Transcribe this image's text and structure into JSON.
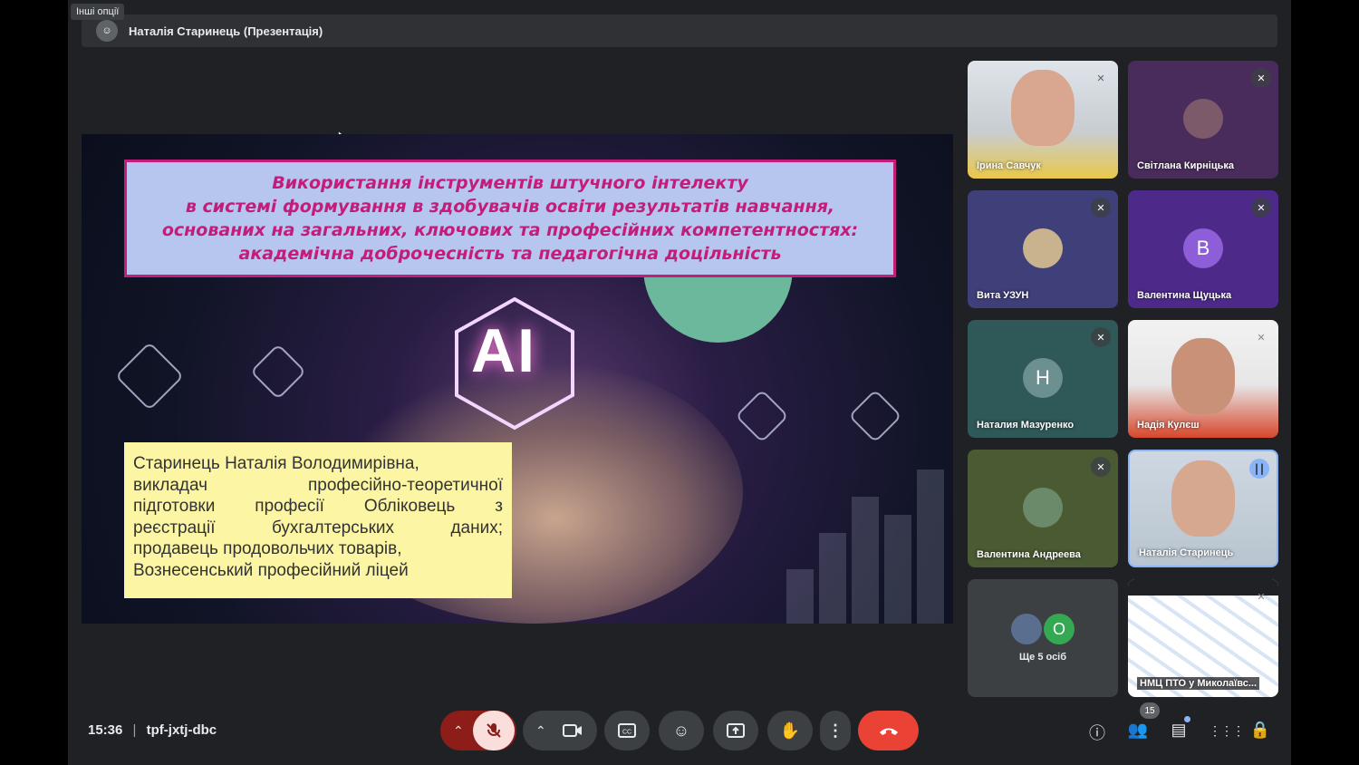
{
  "topbar": {
    "other_options": "Інші опції",
    "presenter": "Наталія Старинець (Презентація)"
  },
  "slide": {
    "title_lines": [
      "Використання інструментів штучного інтелекту",
      "в системі формування в здобувачів освіти результатів навчання,",
      "основаних на загальних, ключових та професійних компетентностях:",
      "академічна доброчесність та педагогічна доцільність"
    ],
    "ai_label": "AI",
    "author_lines": [
      "Старинець Наталія Володимирівна,",
      [
        "викладач",
        "професійно-теоретичної"
      ],
      [
        "підготовки",
        "професії",
        "Обліковець",
        "з"
      ],
      [
        "реєстрації",
        "бухгалтерських",
        "даних;"
      ],
      "продавець продовольчих товарів,",
      "Вознесенський професійний ліцей"
    ]
  },
  "participants": [
    {
      "name": "Ірина Савчук",
      "type": "video",
      "muted": true
    },
    {
      "name": "Світлана Кирніцька",
      "type": "photo",
      "muted": true
    },
    {
      "name": "Вита УЗУН",
      "type": "photo",
      "muted": true
    },
    {
      "name": "Валентина Щуцька",
      "type": "letter",
      "letter": "В",
      "muted": true
    },
    {
      "name": "Наталия Мазуренко",
      "type": "letter",
      "letter": "Н",
      "muted": true
    },
    {
      "name": "Надія Кулєш",
      "type": "video",
      "muted": true
    },
    {
      "name": "Валентина Андреева",
      "type": "photo",
      "muted": true
    },
    {
      "name": "Наталія Старинець",
      "type": "video",
      "speaking": true
    },
    {
      "name": "Ще 5 осіб",
      "type": "more",
      "letter": "О"
    },
    {
      "name": "НМЦ ПТО у Миколаївс...",
      "type": "screen",
      "muted": true
    }
  ],
  "meeting": {
    "time": "15:36",
    "separator": "|",
    "code": "tpf-jxtj-dbc",
    "people_count": "15"
  },
  "colors": {
    "accent": "#8ab4f8",
    "end_call": "#ea4335",
    "mic_muted_bg": "#f9dedc"
  },
  "icons": [
    "chevron-up-icon",
    "mic-off-icon",
    "camera-icon",
    "captions-icon",
    "emoji-icon",
    "present-icon",
    "hand-raise-icon",
    "more-options-icon",
    "end-call-icon",
    "info-icon",
    "people-icon",
    "chat-icon",
    "activities-icon",
    "host-controls-icon"
  ]
}
